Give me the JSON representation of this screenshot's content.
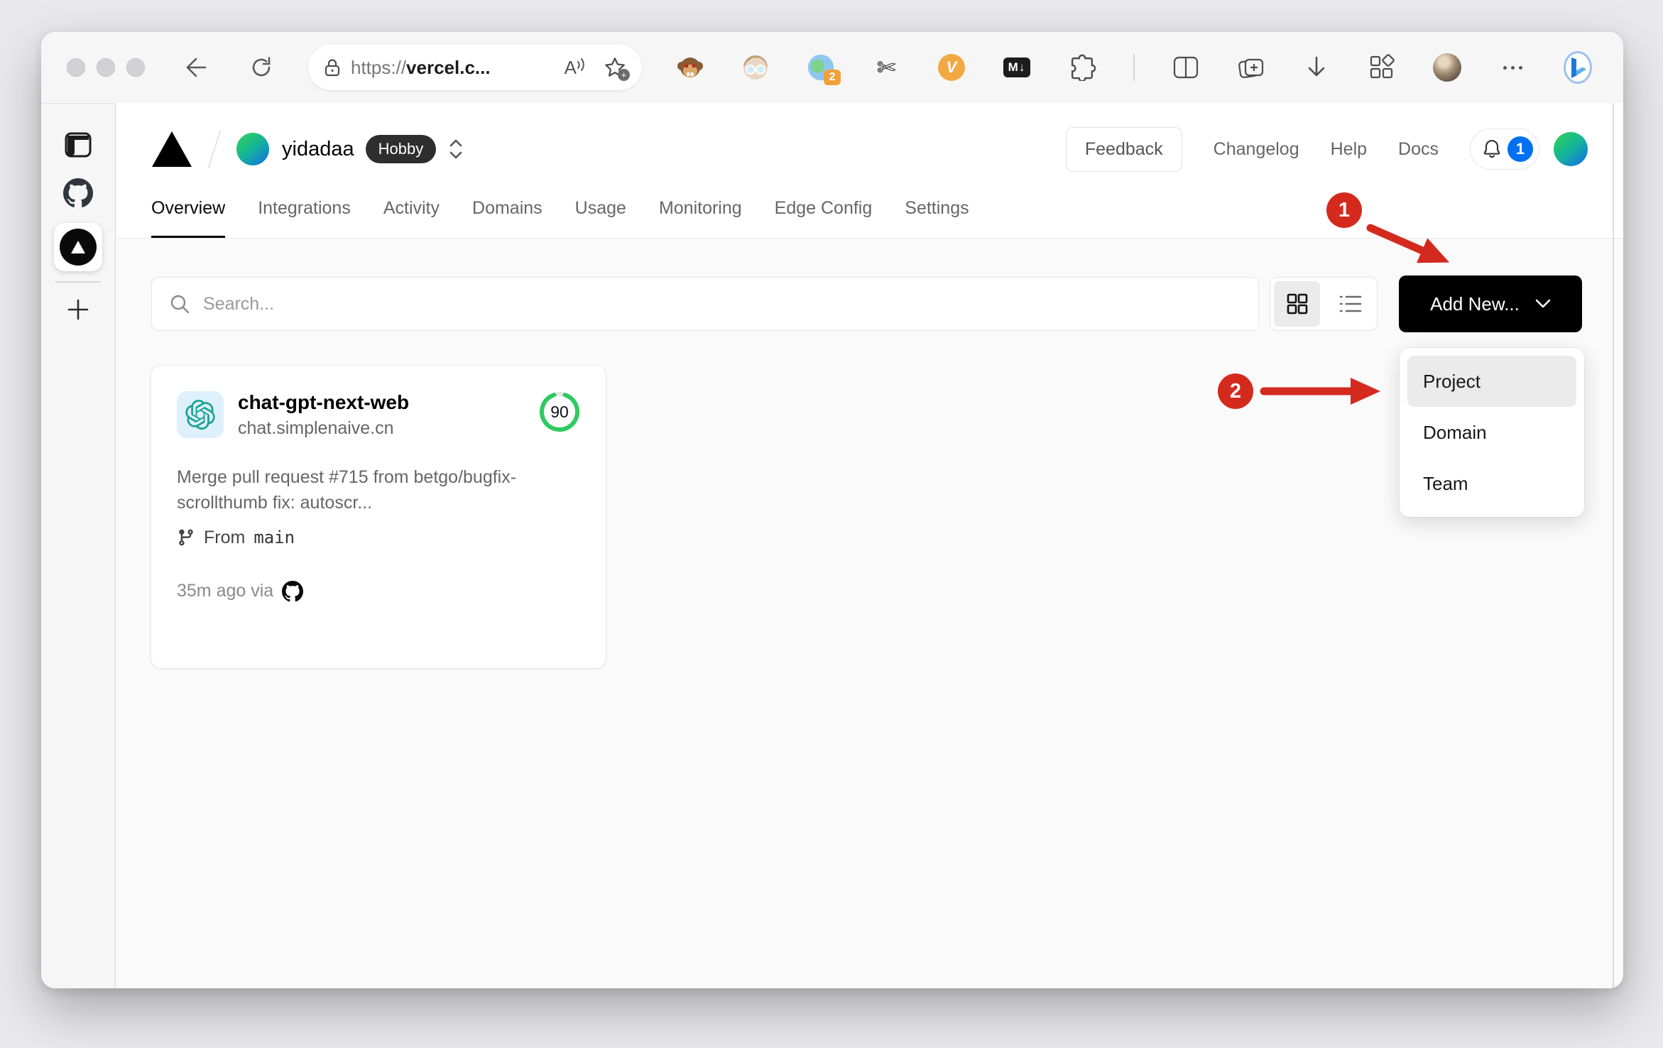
{
  "browser": {
    "url": {
      "scheme": "https://",
      "host": "vercel.c..."
    },
    "read_aloud_label": "A",
    "extensions": {
      "tab_count_badge": "2",
      "markdown_label": "M↓",
      "vimium_label": "V"
    }
  },
  "header": {
    "team_name": "yidadaa",
    "plan_badge": "Hobby",
    "feedback_label": "Feedback",
    "links": [
      {
        "label": "Changelog"
      },
      {
        "label": "Help"
      },
      {
        "label": "Docs"
      }
    ],
    "notification_count": "1"
  },
  "tabs": [
    {
      "label": "Overview",
      "active": true
    },
    {
      "label": "Integrations",
      "active": false
    },
    {
      "label": "Activity",
      "active": false
    },
    {
      "label": "Domains",
      "active": false
    },
    {
      "label": "Usage",
      "active": false
    },
    {
      "label": "Monitoring",
      "active": false
    },
    {
      "label": "Edge Config",
      "active": false
    },
    {
      "label": "Settings",
      "active": false
    }
  ],
  "toolbar": {
    "search_placeholder": "Search...",
    "add_new_label": "Add New..."
  },
  "dropdown": {
    "items": [
      {
        "label": "Project",
        "selected": true
      },
      {
        "label": "Domain",
        "selected": false
      },
      {
        "label": "Team",
        "selected": false
      }
    ]
  },
  "project_card": {
    "name": "chat-gpt-next-web",
    "domain": "chat.simplenaive.cn",
    "score": "90",
    "commit_message": "Merge pull request #715 from betgo/bugfix-scrollthumb fix: autoscr...",
    "branch_label": "From",
    "branch_name": "main",
    "deploy_meta": "35m ago via"
  },
  "annotations": {
    "step_1": "1",
    "step_2": "2"
  },
  "colors": {
    "accent_blue": "#0070f3",
    "score_green": "#2fca5f",
    "annotation_red": "#d42a1e",
    "openai_teal": "#1aa390",
    "add_new_black": "#000000"
  }
}
